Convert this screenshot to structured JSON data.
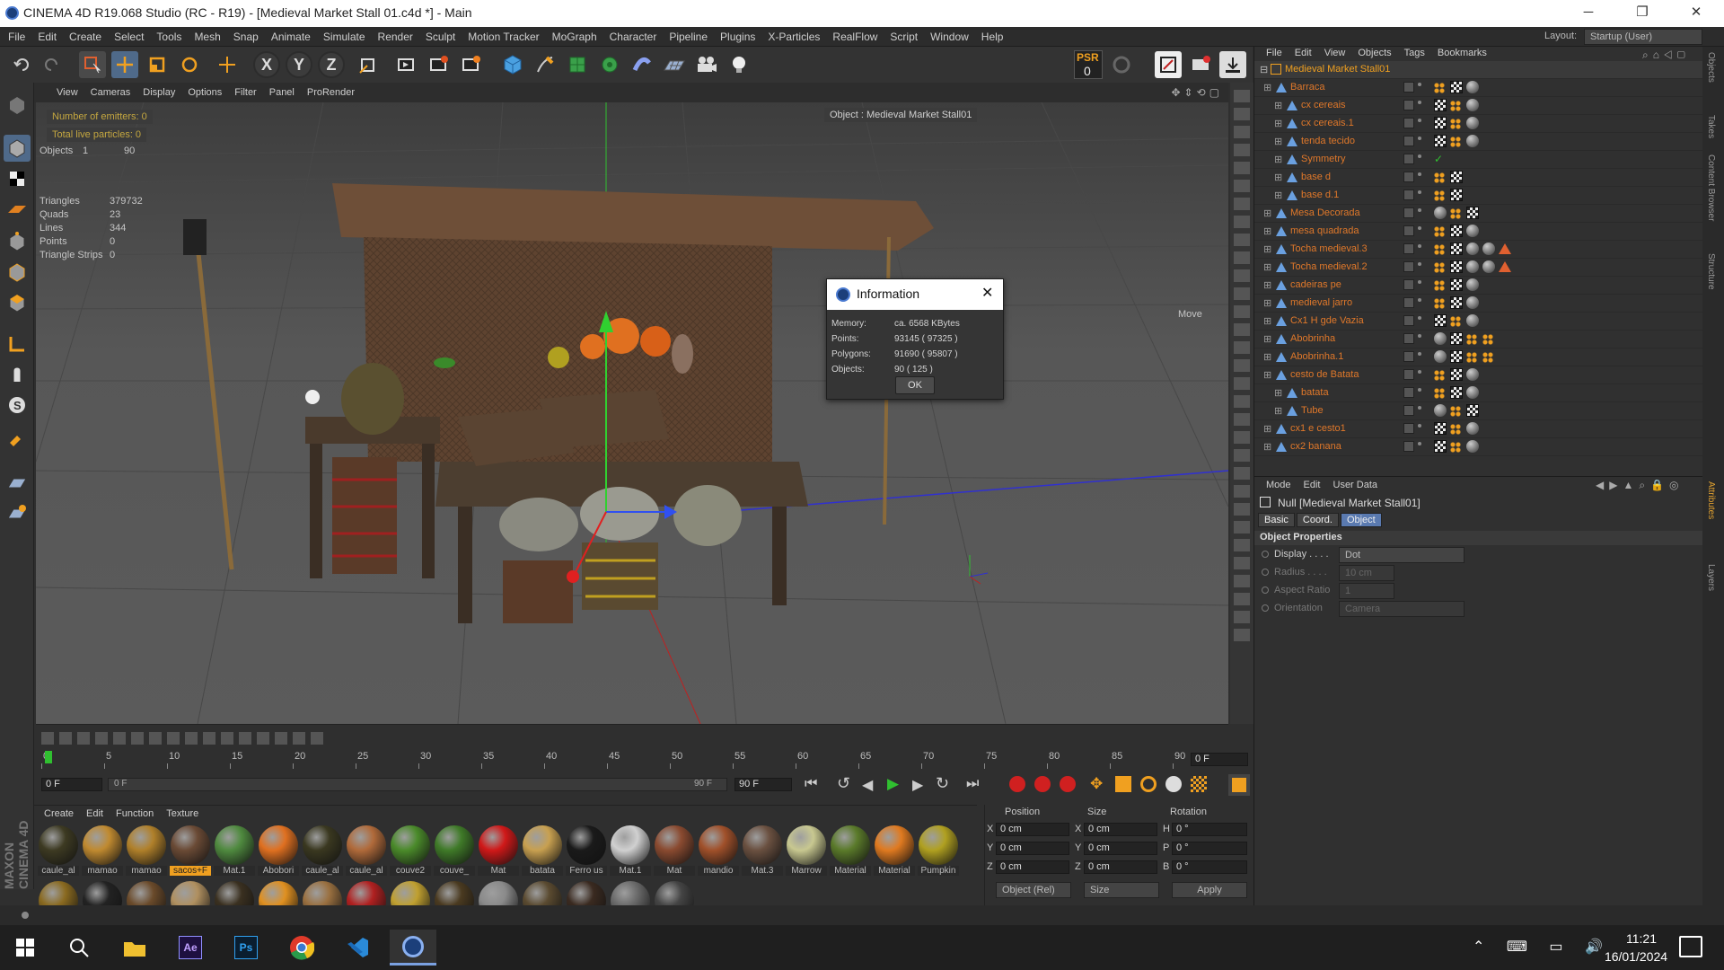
{
  "window": {
    "title": "CINEMA 4D R19.068 Studio (RC - R19) - [Medieval Market Stall 01.c4d *] - Main",
    "controls": [
      "─",
      "❐",
      "✕"
    ]
  },
  "menubar": [
    "File",
    "Edit",
    "Create",
    "Select",
    "Tools",
    "Mesh",
    "Snap",
    "Animate",
    "Simulate",
    "Render",
    "Sculpt",
    "Motion Tracker",
    "MoGraph",
    "Character",
    "Pipeline",
    "Plugins",
    "X-Particles",
    "RealFlow",
    "Script",
    "Window",
    "Help"
  ],
  "layout": {
    "label": "Layout:",
    "value": "Startup (User)"
  },
  "toolbar": {
    "psr_label": "PSR",
    "psr_value": "0",
    "axis_x": "X",
    "axis_y": "Y",
    "axis_z": "Z"
  },
  "viewport": {
    "menu": [
      "View",
      "Cameras",
      "Display",
      "Options",
      "Filter",
      "Panel",
      "ProRender"
    ],
    "hud_emitters": "Number of emitters: 0",
    "hud_particles": "Total live particles: 0",
    "objects_label": "Objects",
    "objects_sel": "1",
    "objects_total": "90",
    "stats": [
      {
        "k": "Triangles",
        "v": "379732"
      },
      {
        "k": "Quads",
        "v": "23"
      },
      {
        "k": "Lines",
        "v": "344"
      },
      {
        "k": "Points",
        "v": "0"
      },
      {
        "k": "Triangle Strips",
        "v": "0"
      }
    ],
    "object_label": "Object : Medieval Market Stall01",
    "move_label": "Move"
  },
  "info_dialog": {
    "title": "Information",
    "rows": [
      {
        "k": "Memory:",
        "v": "ca. 6568 KBytes"
      },
      {
        "k": "Points:",
        "v": "93145 ( 97325 )"
      },
      {
        "k": "Polygons:",
        "v": "91690 ( 95807 )"
      },
      {
        "k": "Objects:",
        "v": "90 ( 125 )"
      }
    ],
    "ok": "OK"
  },
  "timeline": {
    "ticks": [
      "0",
      "5",
      "10",
      "15",
      "20",
      "25",
      "30",
      "35",
      "40",
      "45",
      "50",
      "55",
      "60",
      "65",
      "70",
      "75",
      "80",
      "85",
      "90"
    ],
    "frame_end_field": "0 F",
    "start": "0 F",
    "range_start": "0 F",
    "range_end": "90 F",
    "end": "90 F"
  },
  "materials": {
    "menu": [
      "Create",
      "Edit",
      "Function",
      "Texture"
    ],
    "row1": [
      {
        "name": "caule_al",
        "color": "#3d3a22"
      },
      {
        "name": "mamao",
        "color": "#c08a30"
      },
      {
        "name": "mamao",
        "color": "#b0802a"
      },
      {
        "name": "sacos+F",
        "color": "#6a4a35",
        "selected": true
      },
      {
        "name": "Mat.1",
        "color": "#4f8a3f"
      },
      {
        "name": "Abobori",
        "color": "#e07020"
      },
      {
        "name": "caule_al",
        "color": "#3a3820"
      },
      {
        "name": "caule_al",
        "color": "#b06a3a"
      },
      {
        "name": "couve2",
        "color": "#4a8a2a"
      },
      {
        "name": "couve_",
        "color": "#3f7a28"
      },
      {
        "name": "Mat",
        "color": "#d01818"
      },
      {
        "name": "batata",
        "color": "#c8a050"
      },
      {
        "name": "Ferro us",
        "color": "#1a1a1a"
      },
      {
        "name": "Mat.1",
        "color": "#d0d0d0"
      },
      {
        "name": "Mat",
        "color": "#8a4a30"
      },
      {
        "name": "mandio",
        "color": "#a0502a"
      },
      {
        "name": "Mat.3",
        "color": "#6a5040"
      },
      {
        "name": "Marrow",
        "color": "#c8c890"
      },
      {
        "name": "Material",
        "color": "#5a7a2a"
      },
      {
        "name": "Material",
        "color": "#e07a20"
      },
      {
        "name": "Pumpkin",
        "color": "#b0a020"
      }
    ],
    "row2": [
      "#8a6a20",
      "#222",
      "#6a4a2a",
      "#b09060",
      "#3a3020",
      "#e09020",
      "#9a7040",
      "#b02020",
      "#c0a030",
      "#4a3a20",
      "#8a8a8a",
      "#5a4a30",
      "#3a2a20",
      "#6a6a6a",
      "#444"
    ]
  },
  "coords": {
    "headers": [
      "Position",
      "Size",
      "Rotation"
    ],
    "rows": [
      {
        "axis": "X",
        "pos": "0 cm",
        "saxis": "X",
        "size": "0 cm",
        "raxis": "H",
        "rot": "0 °"
      },
      {
        "axis": "Y",
        "pos": "0 cm",
        "saxis": "Y",
        "size": "0 cm",
        "raxis": "P",
        "rot": "0 °"
      },
      {
        "axis": "Z",
        "pos": "0 cm",
        "saxis": "Z",
        "size": "0 cm",
        "raxis": "B",
        "rot": "0 °"
      }
    ],
    "mode": "Object (Rel)",
    "size_mode": "Size",
    "apply": "Apply"
  },
  "objects": {
    "menu": [
      "File",
      "Edit",
      "View",
      "Objects",
      "Tags",
      "Bookmarks"
    ],
    "root": "Medieval Market Stall01",
    "items": [
      {
        "name": "Barraca",
        "depth": 1
      },
      {
        "name": "cx cereais",
        "depth": 2
      },
      {
        "name": "cx cereais.1",
        "depth": 2
      },
      {
        "name": "tenda tecido",
        "depth": 2
      },
      {
        "name": "Symmetry",
        "depth": 2
      },
      {
        "name": "base d",
        "depth": 2
      },
      {
        "name": "base d.1",
        "depth": 2
      },
      {
        "name": "Mesa Decorada",
        "depth": 1
      },
      {
        "name": "mesa quadrada",
        "depth": 1
      },
      {
        "name": "Tocha medieval.3",
        "depth": 1
      },
      {
        "name": "Tocha medieval.2",
        "depth": 1
      },
      {
        "name": "cadeiras pe",
        "depth": 1
      },
      {
        "name": "medieval jarro",
        "depth": 1
      },
      {
        "name": "Cx1 H gde Vazia",
        "depth": 1
      },
      {
        "name": "Abobrinha",
        "depth": 1
      },
      {
        "name": "Abobrinha.1",
        "depth": 1
      },
      {
        "name": "cesto de Batata",
        "depth": 1
      },
      {
        "name": "batata",
        "depth": 2
      },
      {
        "name": "Tube",
        "depth": 2
      },
      {
        "name": "cx1 e cesto1",
        "depth": 1
      },
      {
        "name": "cx2 banana",
        "depth": 1
      }
    ]
  },
  "attributes": {
    "menu": [
      "Mode",
      "Edit",
      "User Data"
    ],
    "object_title": "Null [Medieval Market Stall01]",
    "tabs": [
      "Basic",
      "Coord.",
      "Object"
    ],
    "section": "Object Properties",
    "props": [
      {
        "k": "Display . . . .",
        "v": "Dot"
      },
      {
        "k": "Radius . . . .",
        "v": "10 cm"
      },
      {
        "k": "Aspect Ratio",
        "v": "1"
      },
      {
        "k": "Orientation",
        "v": "Camera"
      }
    ]
  },
  "right_tabs": [
    "Objects",
    "Takes",
    "Content Browser",
    "Structure"
  ],
  "right_tabs2": [
    "Attributes",
    "Layers"
  ],
  "taskbar": {
    "time": "11:21",
    "date": "16/01/2024"
  },
  "maxon_logo": "MAXON CINEMA 4D"
}
